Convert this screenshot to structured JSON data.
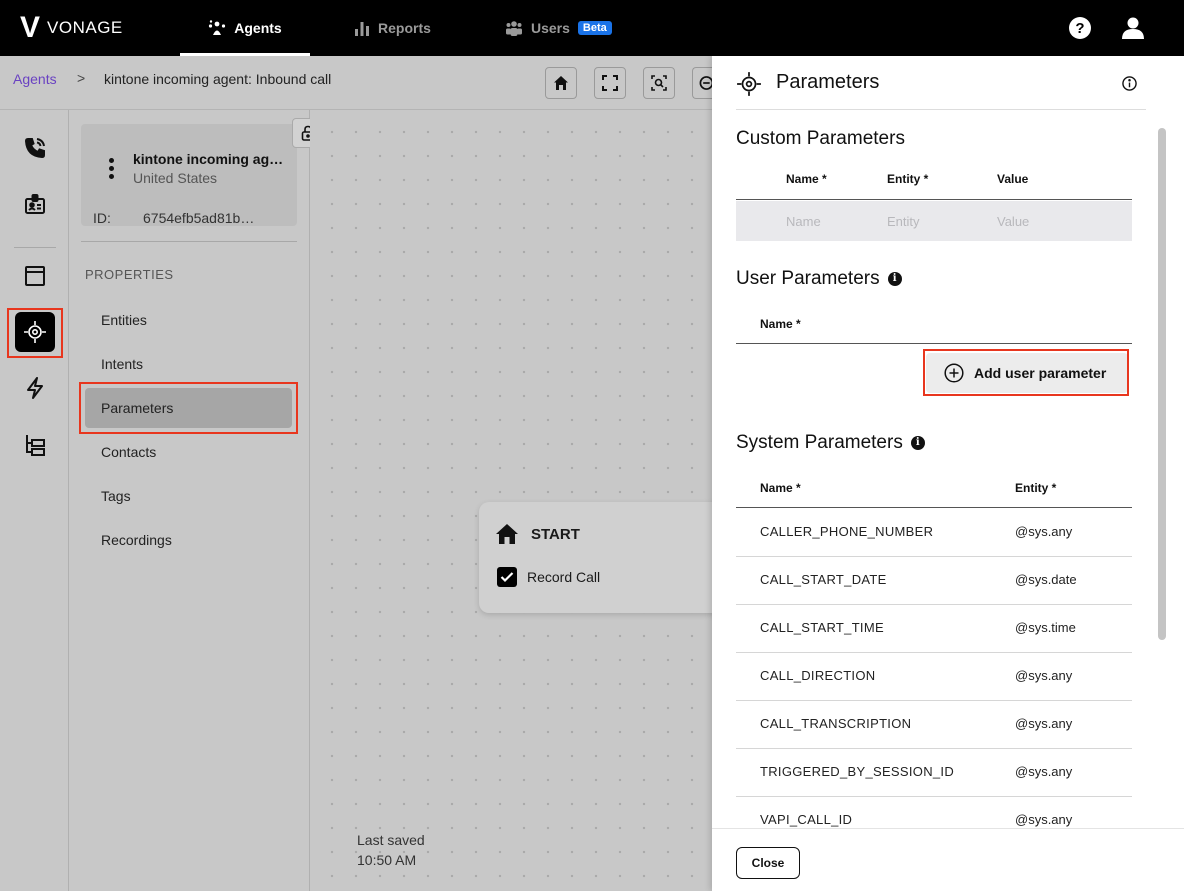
{
  "topbar": {
    "logo_mark": "V",
    "logo_text": "VONAGE",
    "nav": [
      {
        "label": "Agents",
        "active": true
      },
      {
        "label": "Reports",
        "active": false
      },
      {
        "label": "Users",
        "active": false,
        "badge": "Beta"
      }
    ],
    "help_icon": "help-circle-icon",
    "user_icon": "user-icon"
  },
  "breadcrumb": {
    "root": "Agents",
    "separator": ">",
    "current": "kintone incoming agent: Inbound call"
  },
  "rail": {
    "items": [
      {
        "icon": "phone-call-icon"
      },
      {
        "icon": "id-badge-icon"
      },
      {
        "icon": "window-icon"
      },
      {
        "icon": "parameters-icon",
        "active": true
      },
      {
        "icon": "lightning-icon"
      },
      {
        "icon": "tree-icon"
      }
    ]
  },
  "agent": {
    "name": "kintone incoming agent: Inbound call",
    "country": "United States",
    "id_label": "ID:",
    "id_value": "6754efb5ad81b…"
  },
  "properties": {
    "heading": "PROPERTIES",
    "items": [
      "Entities",
      "Intents",
      "Parameters",
      "Contacts",
      "Tags",
      "Recordings"
    ],
    "active": "Parameters"
  },
  "canvas": {
    "start_title": "START",
    "record_call_label": "Record Call",
    "record_call_checked": true,
    "saved_label": "Last saved",
    "saved_time": "10:50 AM"
  },
  "panel": {
    "title": "Parameters",
    "custom": {
      "title": "Custom Parameters",
      "headers": [
        "Name *",
        "Entity *",
        "Value"
      ],
      "placeholders": [
        "Name",
        "Entity",
        "Value"
      ]
    },
    "user": {
      "title": "User Parameters",
      "header": "Name *",
      "add_label": "Add user parameter"
    },
    "system": {
      "title": "System Parameters",
      "headers": [
        "Name *",
        "Entity *"
      ],
      "rows": [
        {
          "name": "CALLER_PHONE_NUMBER",
          "entity": "@sys.any"
        },
        {
          "name": "CALL_START_DATE",
          "entity": "@sys.date"
        },
        {
          "name": "CALL_START_TIME",
          "entity": "@sys.time"
        },
        {
          "name": "CALL_DIRECTION",
          "entity": "@sys.any"
        },
        {
          "name": "CALL_TRANSCRIPTION",
          "entity": "@sys.any"
        },
        {
          "name": "TRIGGERED_BY_SESSION_ID",
          "entity": "@sys.any"
        },
        {
          "name": "VAPI_CALL_ID",
          "entity": "@sys.any"
        }
      ]
    },
    "close_label": "Close"
  },
  "colors": {
    "accent_link": "#6a42c2",
    "beta_badge": "#1a73e8",
    "annotation": "#e8361e"
  }
}
